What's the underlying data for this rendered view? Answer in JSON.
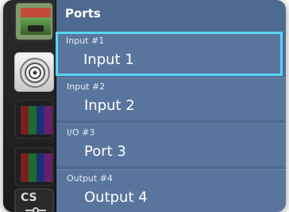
{
  "panel": {
    "title": "Ports"
  },
  "rail": {
    "items": [
      {
        "icon": "scene-thumbnail-icon"
      },
      {
        "icon": "bnc-connector-icon"
      },
      {
        "icon": "color-bars-icon"
      },
      {
        "icon": "color-bars-icon"
      },
      {
        "icon": "cs-connector-icon",
        "label": "CS"
      }
    ]
  },
  "ports": [
    {
      "header": "Input #1",
      "name": "Input 1",
      "selected": true
    },
    {
      "header": "Input #2",
      "name": "Input 2",
      "selected": false
    },
    {
      "header": "I/O #3",
      "name": "Port 3",
      "selected": false
    },
    {
      "header": "Output #4",
      "name": "Output 4",
      "selected": false
    }
  ],
  "colors": {
    "panel_bg": "#4f6a91",
    "row_bg": "#5a759d",
    "selection": "#5ad3f0",
    "rail_bg": "#1f1f1f"
  }
}
